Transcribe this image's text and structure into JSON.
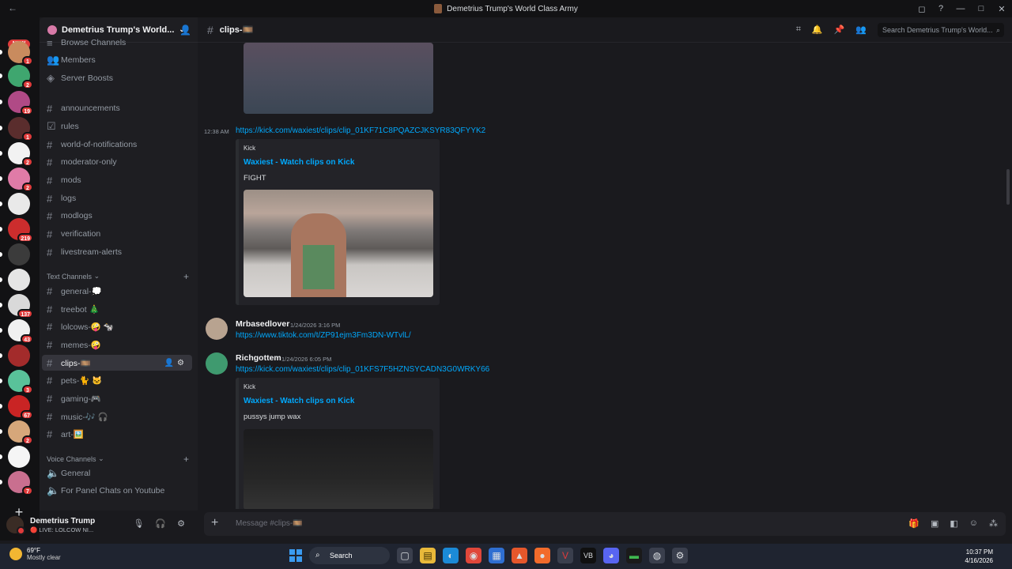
{
  "window": {
    "title": "Demetrius Trump's World Class Army",
    "back": "←",
    "controls": [
      "◻",
      "?",
      "—",
      "□",
      "✕"
    ]
  },
  "servers": {
    "new_label": "NEW",
    "items": [
      {
        "color": "#c98b5e",
        "badge": "1"
      },
      {
        "color": "#3fa66f",
        "badge": "2"
      },
      {
        "color": "#b04a86",
        "badge": "19"
      },
      {
        "color": "#5a2d2d",
        "badge": "1"
      },
      {
        "color": "#f2f2f2",
        "badge": "2"
      },
      {
        "color": "#e07ba7",
        "badge": "2"
      },
      {
        "color": "#e9e9e9",
        "badge": ""
      },
      {
        "color": "#cc2d2d",
        "badge": "219"
      },
      {
        "color": "#3b3b3b",
        "badge": ""
      },
      {
        "color": "#e5e5e5",
        "badge": ""
      },
      {
        "color": "#d9d9d9",
        "badge": "137"
      },
      {
        "color": "#f0f0f0",
        "badge": "43"
      },
      {
        "color": "#a32b2b",
        "badge": ""
      },
      {
        "color": "#59c29a",
        "badge": "3"
      },
      {
        "color": "#c92424",
        "badge": "67"
      },
      {
        "color": "#d6a77a",
        "badge": "2"
      },
      {
        "color": "#f5f5f5",
        "badge": ""
      },
      {
        "color": "#c96f8f",
        "badge": "7"
      }
    ]
  },
  "sidebar": {
    "server_name": "Demetrius Trump's World...",
    "top_items": [
      "Browse Channels",
      "Members",
      "Server Boosts"
    ],
    "channels": [
      "announcements",
      "rules",
      "world-of-notifications",
      "moderator-only",
      "mods",
      "logs",
      "modlogs",
      "verification",
      "livestream-alerts"
    ],
    "text_category": "Text Channels",
    "text_channels": [
      "general-💭",
      "treebot 🎄",
      "lolcows-🤪 🐄",
      "memes-🤪",
      "clips-🎞️",
      "pets-🐈 🐱",
      "gaming-🎮",
      "music-🎶 🎧",
      "art-🖼️"
    ],
    "voice_category": "Voice Channels",
    "voice_channels": [
      "General",
      "For Panel Chats on Youtube"
    ]
  },
  "user": {
    "name": "Demetrius Trump",
    "status": "🔴 LIVE: LOLCOW NI..."
  },
  "header": {
    "channel": "clips-🎞️",
    "search_placeholder": "Search Demetrius Trump's World..."
  },
  "messages": {
    "msg1": {
      "time": "12:38 AM",
      "link": "https://kick.com/waxiest/clips/clip_01KF71C8PQAZCJKSYR83QFYYK2",
      "provider": "Kick",
      "title": "Waxiest - Watch clips on Kick",
      "desc": "FIGHT"
    },
    "msg2": {
      "author": "Mrbasedlover",
      "time": "1/24/2026 3:16 PM",
      "link": "https://www.tiktok.com/t/ZP91ejm3Fm3DN-WTvlL/"
    },
    "msg3": {
      "author": "Richgottem",
      "time": "1/24/2026 6:05 PM",
      "link": "https://kick.com/waxiest/clips/clip_01KFS7F5HZNSYCADN3G0WRKY66",
      "provider": "Kick",
      "title": "Waxiest - Watch clips on Kick",
      "desc": "pussys jump wax"
    }
  },
  "composer": {
    "placeholder": "Message #clips-🎞️"
  },
  "taskbar": {
    "temp": "69°F",
    "weather": "Mostly clear",
    "search": "Search",
    "time": "10:37 PM",
    "date": "4/16/2026"
  }
}
